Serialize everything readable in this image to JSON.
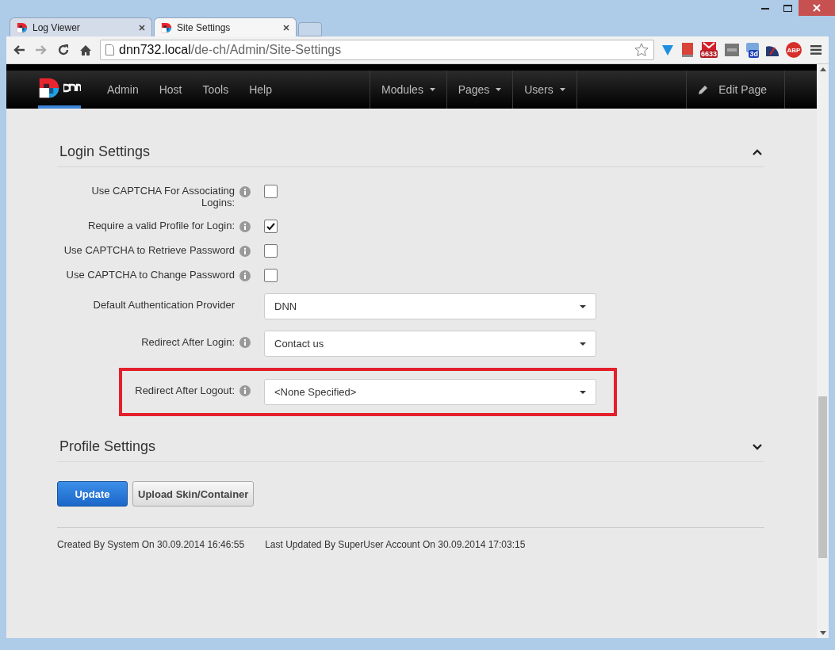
{
  "browser": {
    "tabs": [
      {
        "title": "Log Viewer",
        "selected": false
      },
      {
        "title": "Site Settings",
        "selected": true
      }
    ],
    "address": {
      "host": "dnn732.local",
      "path": "/de-ch/Admin/Site-Settings"
    },
    "extensions": [
      {
        "kind": "funnel"
      },
      {
        "kind": "book"
      },
      {
        "kind": "mail",
        "badge": "6633"
      },
      {
        "kind": "keyboard"
      },
      {
        "kind": "calendar",
        "badge": "3d"
      },
      {
        "kind": "gauge"
      },
      {
        "kind": "stop",
        "badge": "ABP"
      }
    ]
  },
  "nav": {
    "main": [
      "Admin",
      "Host",
      "Tools",
      "Help"
    ],
    "menus": [
      "Modules",
      "Pages",
      "Users"
    ],
    "edit": "Edit Page"
  },
  "sections": [
    {
      "title": "Login Settings",
      "expanded": true,
      "fields": [
        {
          "kind": "checkbox",
          "label": "Use CAPTCHA For Associating Logins:",
          "info": true,
          "checked": false,
          "highlighted": false
        },
        {
          "kind": "checkbox",
          "label": "Require a valid Profile for Login:",
          "info": true,
          "checked": true,
          "highlighted": false
        },
        {
          "kind": "checkbox",
          "label": "Use CAPTCHA to Retrieve Password",
          "info": true,
          "checked": false,
          "highlighted": false
        },
        {
          "kind": "checkbox",
          "label": "Use CAPTCHA to Change Password",
          "info": true,
          "checked": false,
          "highlighted": false
        },
        {
          "kind": "dropdown",
          "label": "Default Authentication Provider",
          "info": false,
          "value": "DNN",
          "highlighted": false
        },
        {
          "kind": "dropdown",
          "label": "Redirect After Login:",
          "info": true,
          "value": "Contact us",
          "highlighted": false
        },
        {
          "kind": "dropdown",
          "label": "Redirect After Logout:",
          "info": true,
          "value": "<None Specified>",
          "highlighted": true
        }
      ]
    },
    {
      "title": "Profile Settings",
      "expanded": false
    }
  ],
  "buttons": [
    {
      "label": "Update",
      "kind": "primary"
    },
    {
      "label": "Upload Skin/Container",
      "kind": "secondary"
    }
  ],
  "footer": {
    "created": "Created By System On 30.09.2014 16:46:55",
    "updated": "Last Updated By SuperUser Account On 30.09.2014 17:03:15"
  }
}
